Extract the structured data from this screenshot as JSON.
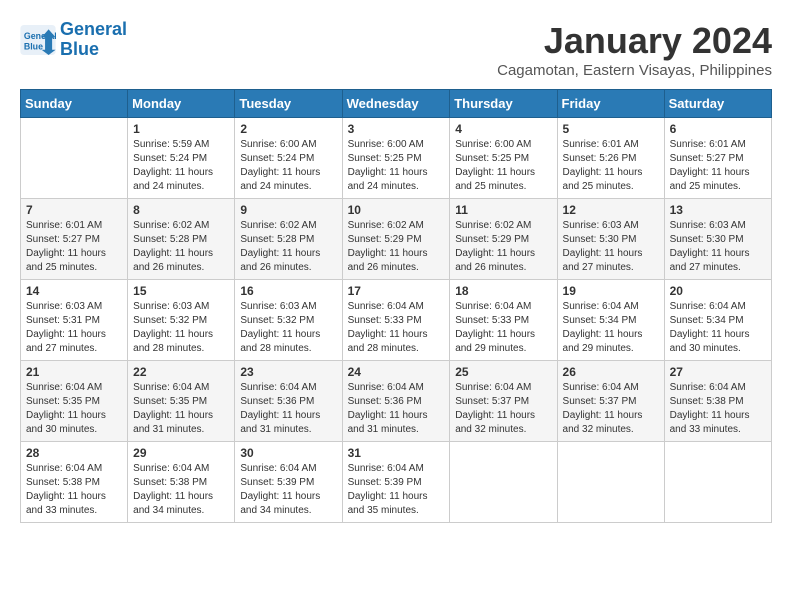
{
  "header": {
    "logo_line1": "General",
    "logo_line2": "Blue",
    "month_title": "January 2024",
    "subtitle": "Cagamotan, Eastern Visayas, Philippines"
  },
  "weekdays": [
    "Sunday",
    "Monday",
    "Tuesday",
    "Wednesday",
    "Thursday",
    "Friday",
    "Saturday"
  ],
  "weeks": [
    [
      {
        "day": "",
        "info": ""
      },
      {
        "day": "1",
        "info": "Sunrise: 5:59 AM\nSunset: 5:24 PM\nDaylight: 11 hours\nand 24 minutes."
      },
      {
        "day": "2",
        "info": "Sunrise: 6:00 AM\nSunset: 5:24 PM\nDaylight: 11 hours\nand 24 minutes."
      },
      {
        "day": "3",
        "info": "Sunrise: 6:00 AM\nSunset: 5:25 PM\nDaylight: 11 hours\nand 24 minutes."
      },
      {
        "day": "4",
        "info": "Sunrise: 6:00 AM\nSunset: 5:25 PM\nDaylight: 11 hours\nand 25 minutes."
      },
      {
        "day": "5",
        "info": "Sunrise: 6:01 AM\nSunset: 5:26 PM\nDaylight: 11 hours\nand 25 minutes."
      },
      {
        "day": "6",
        "info": "Sunrise: 6:01 AM\nSunset: 5:27 PM\nDaylight: 11 hours\nand 25 minutes."
      }
    ],
    [
      {
        "day": "7",
        "info": "Sunrise: 6:01 AM\nSunset: 5:27 PM\nDaylight: 11 hours\nand 25 minutes."
      },
      {
        "day": "8",
        "info": "Sunrise: 6:02 AM\nSunset: 5:28 PM\nDaylight: 11 hours\nand 26 minutes."
      },
      {
        "day": "9",
        "info": "Sunrise: 6:02 AM\nSunset: 5:28 PM\nDaylight: 11 hours\nand 26 minutes."
      },
      {
        "day": "10",
        "info": "Sunrise: 6:02 AM\nSunset: 5:29 PM\nDaylight: 11 hours\nand 26 minutes."
      },
      {
        "day": "11",
        "info": "Sunrise: 6:02 AM\nSunset: 5:29 PM\nDaylight: 11 hours\nand 26 minutes."
      },
      {
        "day": "12",
        "info": "Sunrise: 6:03 AM\nSunset: 5:30 PM\nDaylight: 11 hours\nand 27 minutes."
      },
      {
        "day": "13",
        "info": "Sunrise: 6:03 AM\nSunset: 5:30 PM\nDaylight: 11 hours\nand 27 minutes."
      }
    ],
    [
      {
        "day": "14",
        "info": "Sunrise: 6:03 AM\nSunset: 5:31 PM\nDaylight: 11 hours\nand 27 minutes."
      },
      {
        "day": "15",
        "info": "Sunrise: 6:03 AM\nSunset: 5:32 PM\nDaylight: 11 hours\nand 28 minutes."
      },
      {
        "day": "16",
        "info": "Sunrise: 6:03 AM\nSunset: 5:32 PM\nDaylight: 11 hours\nand 28 minutes."
      },
      {
        "day": "17",
        "info": "Sunrise: 6:04 AM\nSunset: 5:33 PM\nDaylight: 11 hours\nand 28 minutes."
      },
      {
        "day": "18",
        "info": "Sunrise: 6:04 AM\nSunset: 5:33 PM\nDaylight: 11 hours\nand 29 minutes."
      },
      {
        "day": "19",
        "info": "Sunrise: 6:04 AM\nSunset: 5:34 PM\nDaylight: 11 hours\nand 29 minutes."
      },
      {
        "day": "20",
        "info": "Sunrise: 6:04 AM\nSunset: 5:34 PM\nDaylight: 11 hours\nand 30 minutes."
      }
    ],
    [
      {
        "day": "21",
        "info": "Sunrise: 6:04 AM\nSunset: 5:35 PM\nDaylight: 11 hours\nand 30 minutes."
      },
      {
        "day": "22",
        "info": "Sunrise: 6:04 AM\nSunset: 5:35 PM\nDaylight: 11 hours\nand 31 minutes."
      },
      {
        "day": "23",
        "info": "Sunrise: 6:04 AM\nSunset: 5:36 PM\nDaylight: 11 hours\nand 31 minutes."
      },
      {
        "day": "24",
        "info": "Sunrise: 6:04 AM\nSunset: 5:36 PM\nDaylight: 11 hours\nand 31 minutes."
      },
      {
        "day": "25",
        "info": "Sunrise: 6:04 AM\nSunset: 5:37 PM\nDaylight: 11 hours\nand 32 minutes."
      },
      {
        "day": "26",
        "info": "Sunrise: 6:04 AM\nSunset: 5:37 PM\nDaylight: 11 hours\nand 32 minutes."
      },
      {
        "day": "27",
        "info": "Sunrise: 6:04 AM\nSunset: 5:38 PM\nDaylight: 11 hours\nand 33 minutes."
      }
    ],
    [
      {
        "day": "28",
        "info": "Sunrise: 6:04 AM\nSunset: 5:38 PM\nDaylight: 11 hours\nand 33 minutes."
      },
      {
        "day": "29",
        "info": "Sunrise: 6:04 AM\nSunset: 5:38 PM\nDaylight: 11 hours\nand 34 minutes."
      },
      {
        "day": "30",
        "info": "Sunrise: 6:04 AM\nSunset: 5:39 PM\nDaylight: 11 hours\nand 34 minutes."
      },
      {
        "day": "31",
        "info": "Sunrise: 6:04 AM\nSunset: 5:39 PM\nDaylight: 11 hours\nand 35 minutes."
      },
      {
        "day": "",
        "info": ""
      },
      {
        "day": "",
        "info": ""
      },
      {
        "day": "",
        "info": ""
      }
    ]
  ]
}
